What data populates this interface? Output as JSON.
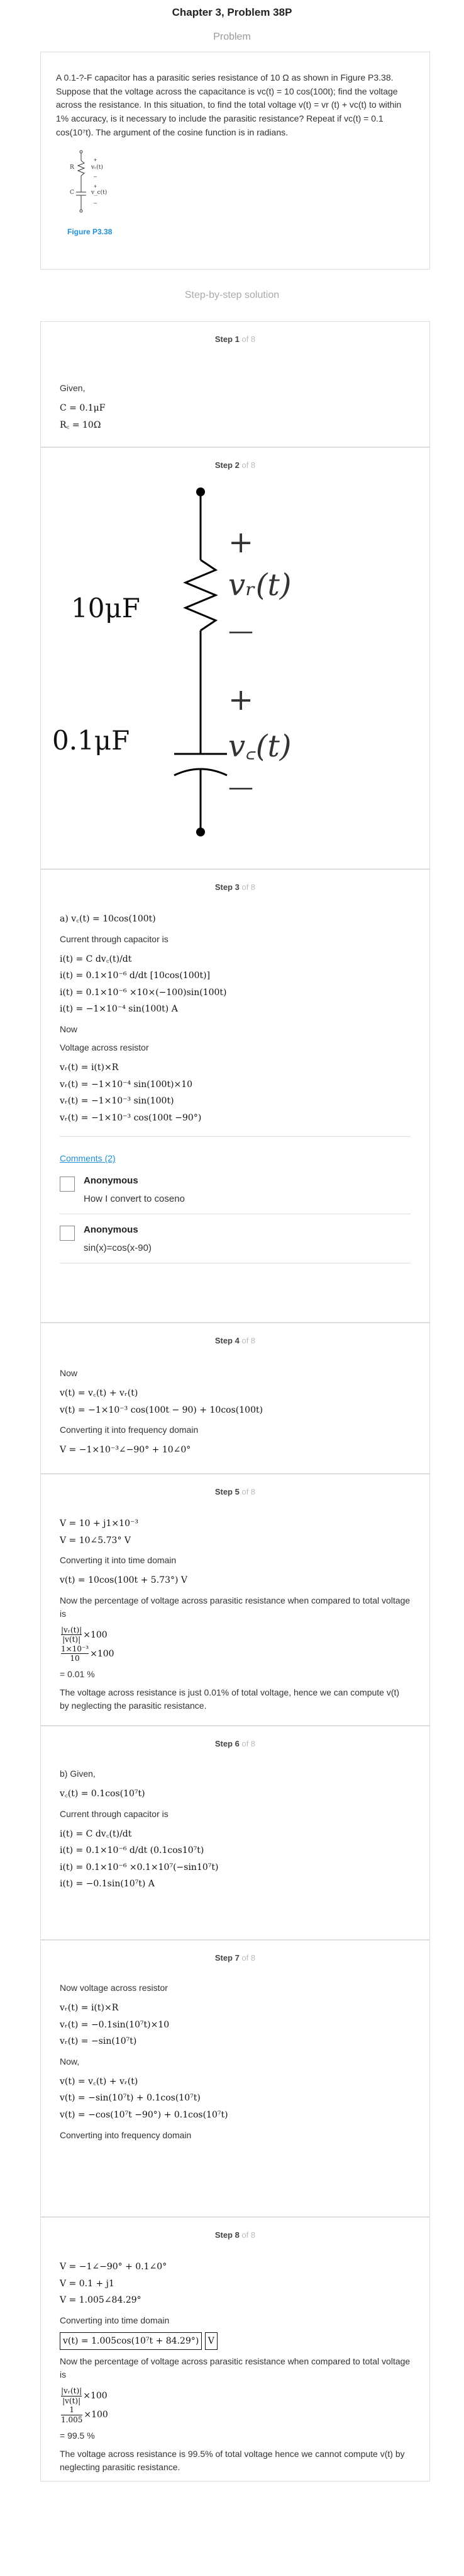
{
  "header": {
    "chapter_title": "Chapter 3, Problem 38P",
    "problem_label": "Problem"
  },
  "problem": {
    "text": "A 0.1-?-F capacitor has a parasitic series resistance of 10 Ω as shown in Figure P3.38. Suppose that the voltage across the capacitance is vc(t) = 10 cos(100t); find the voltage across the resistance. In this situation, to find the total voltage v(t) = vr (t) + vc(t) to within 1% accuracy, is it necessary to include the parasitic resistance? Repeat if vc(t) = 0.1 cos(10⁷t). The argument of the cosine function is in radians.",
    "figure_caption": "Figure P3.38",
    "fig_labels": {
      "r": "R",
      "c": "C",
      "vr": "vᵣ(t)",
      "vc": "v_c(t)",
      "plus": "+",
      "minus": "–"
    }
  },
  "solution_label": "Step-by-step solution",
  "steps": [
    {
      "label": "Step 1",
      "of": "of 8"
    },
    {
      "label": "Step 2",
      "of": "of 8"
    },
    {
      "label": "Step 3",
      "of": "of 8"
    },
    {
      "label": "Step 4",
      "of": "of 8"
    },
    {
      "label": "Step 5",
      "of": "of 8"
    },
    {
      "label": "Step 6",
      "of": "of 8"
    },
    {
      "label": "Step 7",
      "of": "of 8"
    },
    {
      "label": "Step 8",
      "of": "of 8"
    }
  ],
  "step1": {
    "given": "Given,",
    "c": "C = 0.1μF",
    "r": "R꜀ = 10Ω"
  },
  "step2": {
    "r_label": "10μF",
    "c_label": "0.1μF",
    "vr": "vᵣ(t)",
    "vc": "v꜀(t)",
    "plus": "+",
    "minus": "—"
  },
  "step3": {
    "a": "a)  v꜀(t) = 10cos(100t)",
    "t1": "Current through capacitor is",
    "e1": "i(t) = C dv꜀(t)/dt",
    "e2": "i(t) = 0.1×10⁻⁶ d/dt [10cos(100t)]",
    "e3": "i(t) = 0.1×10⁻⁶ ×10×(−100)sin(100t)",
    "e4": "i(t) = −1×10⁻⁴ sin(100t)  A",
    "t2": "Now",
    "t3": "Voltage across resistor",
    "e5": "vᵣ(t) = i(t)×R",
    "e6": "vᵣ(t) = −1×10⁻⁴ sin(100t)×10",
    "e7": "vᵣ(t) = −1×10⁻³ sin(100t)",
    "e8": "vᵣ(t) = −1×10⁻³ cos(100t −90°)",
    "comments_link": "Comments (2)",
    "comments": [
      {
        "name": "Anonymous",
        "text": "How I convert to coseno"
      },
      {
        "name": "Anonymous",
        "text": "sin(x)=cos(x-90)"
      }
    ]
  },
  "step4": {
    "t1": "Now",
    "e1": "v(t) = v꜀(t) + vᵣ(t)",
    "e2": "v(t) = −1×10⁻³ cos(100t − 90) + 10cos(100t)",
    "t2": "Converting it into frequency domain",
    "e3": "V = −1×10⁻³∠−90° + 10∠0°"
  },
  "step5": {
    "e1": "V = 10 + j1×10⁻³",
    "e2": "V = 10∠5.73° V",
    "t1": "Converting it into time domain",
    "e3": "v(t) = 10cos(100t + 5.73°) V",
    "t2": "Now the percentage of voltage across parasitic resistance when compared to total voltage is",
    "f1n": "|vᵣ(t)|",
    "f1d": "|v(t)|",
    "x100": "×100",
    "f2n": "1×10⁻³",
    "f2d": "10",
    "res": "= 0.01 %",
    "t3": "The voltage across resistance is just 0.01% of total voltage, hence we can compute  v(t) by neglecting the parasitic resistance."
  },
  "step6": {
    "b": "b) Given,",
    "e0": "v꜀(t) = 0.1cos(10⁷t)",
    "t1": "Current through capacitor is",
    "e1": "i(t) = C dv꜀(t)/dt",
    "e2": "i(t) = 0.1×10⁻⁶ d/dt (0.1cos10⁷t)",
    "e3": "i(t) = 0.1×10⁻⁶ ×0.1×10⁷(−sin10⁷t)",
    "e4": "i(t) = −0.1sin(10⁷t)  A"
  },
  "step7": {
    "t1": "Now voltage across resistor",
    "e1": "vᵣ(t) = i(t)×R",
    "e2": "vᵣ(t) = −0.1sin(10⁷t)×10",
    "e3": "vᵣ(t) = −sin(10⁷t)",
    "t2": "Now,",
    "e4": "v(t) = v꜀(t) + vᵣ(t)",
    "e5": "v(t) = −sin(10⁷t) + 0.1cos(10⁷t)",
    "e6": "v(t) = −cos(10⁷t −90°) + 0.1cos(10⁷t)",
    "t3": "Converting into frequency domain"
  },
  "step8": {
    "e1": "V = −1∠−90° + 0.1∠0°",
    "e2": "V = 0.1 + j1",
    "e3": "V = 1.005∠84.29°",
    "t1": "Converting into time domain",
    "e4": "v(t) = 1.005cos(10⁷t + 84.29°)",
    "unit": "V",
    "t2": "Now the percentage of voltage across parasitic resistance when compared to total voltage is",
    "f1n": "|vᵣ(t)|",
    "f1d": "|v(t)|",
    "x100": "×100",
    "f2n": "1",
    "f2d": "1.005",
    "res": "= 99.5 %",
    "t3": "The voltage across resistance is 99.5% of total voltage hence we cannot compute  v(t) by neglecting parasitic resistance."
  }
}
